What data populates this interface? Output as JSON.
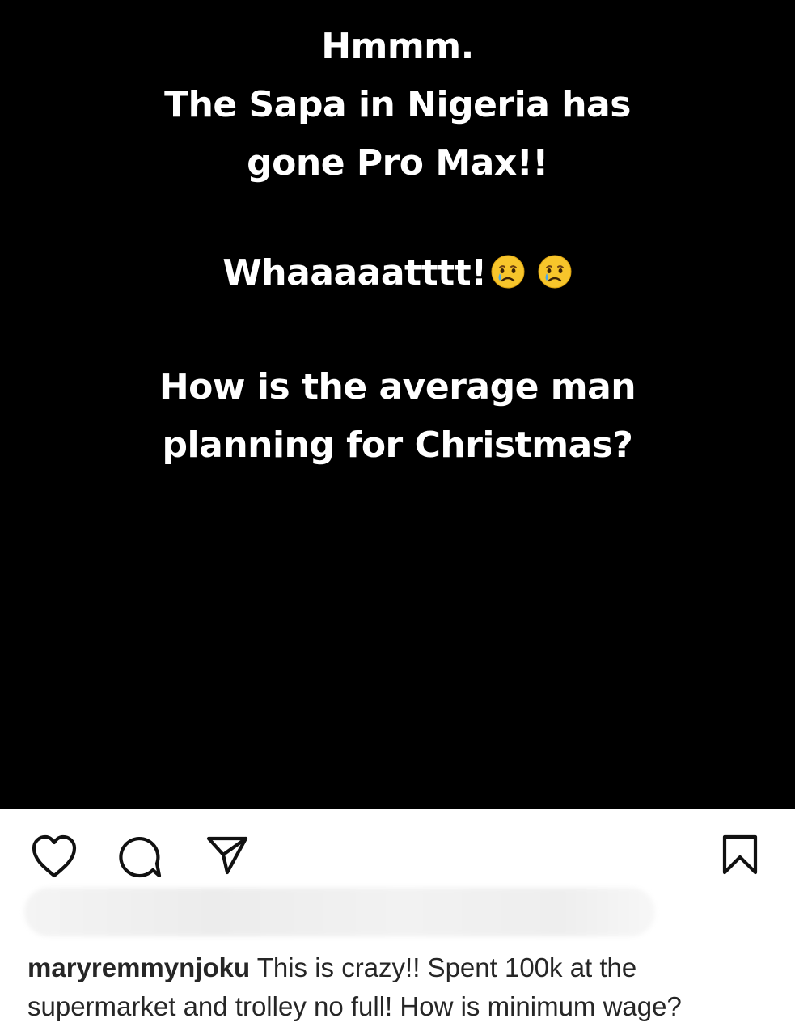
{
  "post_image": {
    "lines_block_1": [
      "Hmmm.",
      "The Sapa in Nigeria has",
      "gone Pro Max!!"
    ],
    "line_block_2": "Whaaaaatttt!",
    "emojis_block_2": [
      "crying-face-emoji",
      "crying-face-emoji"
    ],
    "lines_block_3": [
      "How is the average man",
      "planning for Christmas?"
    ],
    "background_color": "#000000",
    "text_color": "#ffffff"
  },
  "actions": {
    "icons": [
      "heart-icon",
      "comment-bubble-icon",
      "send-icon",
      "bookmark-icon"
    ]
  },
  "caption": {
    "username": "maryremmynjoku",
    "text": " This is crazy!! Spent 100k at the supermarket and trolley no full! How is minimum wage?"
  }
}
